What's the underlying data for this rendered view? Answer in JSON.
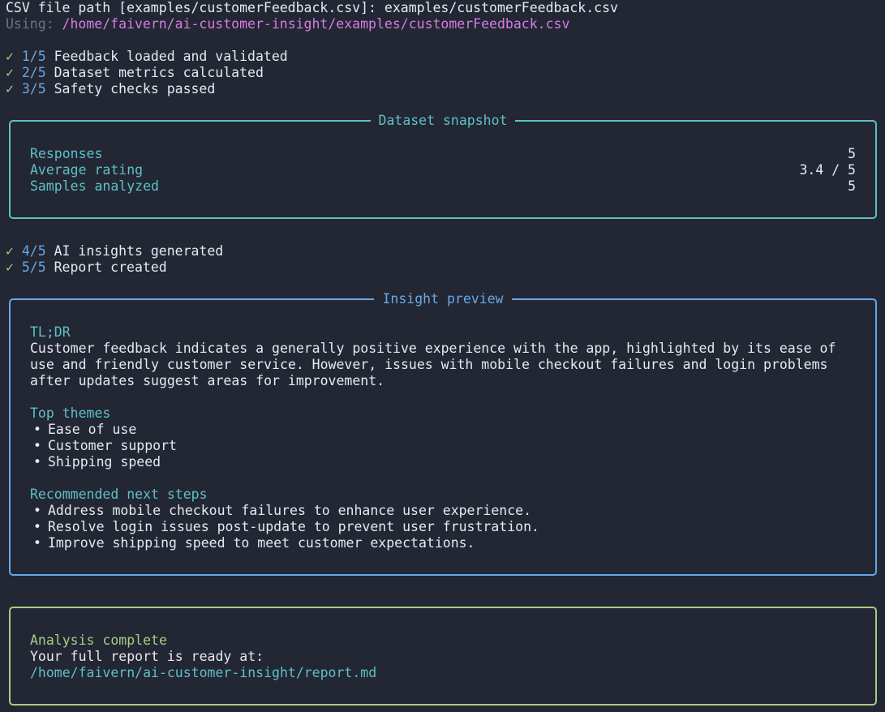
{
  "prompt": {
    "text": "CSV file path [examples/customerFeedback.csv]: examples/customerFeedback.csv",
    "using_label": "Using: ",
    "using_path": "/home/faivern/ai-customer-insight/examples/customerFeedback.csv"
  },
  "check_glyph": "✓",
  "steps_before": [
    {
      "step": "1/5",
      "label": "Feedback loaded and validated"
    },
    {
      "step": "2/5",
      "label": "Dataset metrics calculated"
    },
    {
      "step": "3/5",
      "label": "Safety checks passed"
    }
  ],
  "dataset_snapshot": {
    "title": "Dataset snapshot",
    "rows": [
      {
        "label": "Responses",
        "value": "5"
      },
      {
        "label": "Average rating",
        "value": "3.4 / 5"
      },
      {
        "label": "Samples analyzed",
        "value": "5"
      }
    ]
  },
  "steps_after": [
    {
      "step": "4/5",
      "label": "AI insights generated"
    },
    {
      "step": "5/5",
      "label": "Report created"
    }
  ],
  "insight_preview": {
    "title": "Insight preview",
    "tldr_heading": "TL;DR",
    "tldr_lines": [
      "Customer feedback indicates a generally positive experience with the app, highlighted by its ease of",
      "use and friendly customer service. However, issues with mobile checkout failures and login problems",
      "after updates suggest areas for improvement."
    ],
    "themes_heading": "Top themes",
    "themes": [
      "Ease of use",
      "Customer support",
      "Shipping speed"
    ],
    "next_steps_heading": "Recommended next steps",
    "next_steps": [
      "Address mobile checkout failures to enhance user experience.",
      "Resolve login issues post-update to prevent user frustration.",
      "Improve shipping speed to meet customer expectations."
    ]
  },
  "completion": {
    "heading": "Analysis complete",
    "message": "Your full report is ready at:",
    "report_path": "/home/faivern/ai-customer-insight/report.md"
  },
  "colors": {
    "background": "#222733",
    "text": "#e6e9ef",
    "muted": "#6b7486",
    "magenta": "#d77ce6",
    "green": "#a7cc84",
    "blue": "#69a8e6",
    "cyan": "#5fc0c7"
  }
}
